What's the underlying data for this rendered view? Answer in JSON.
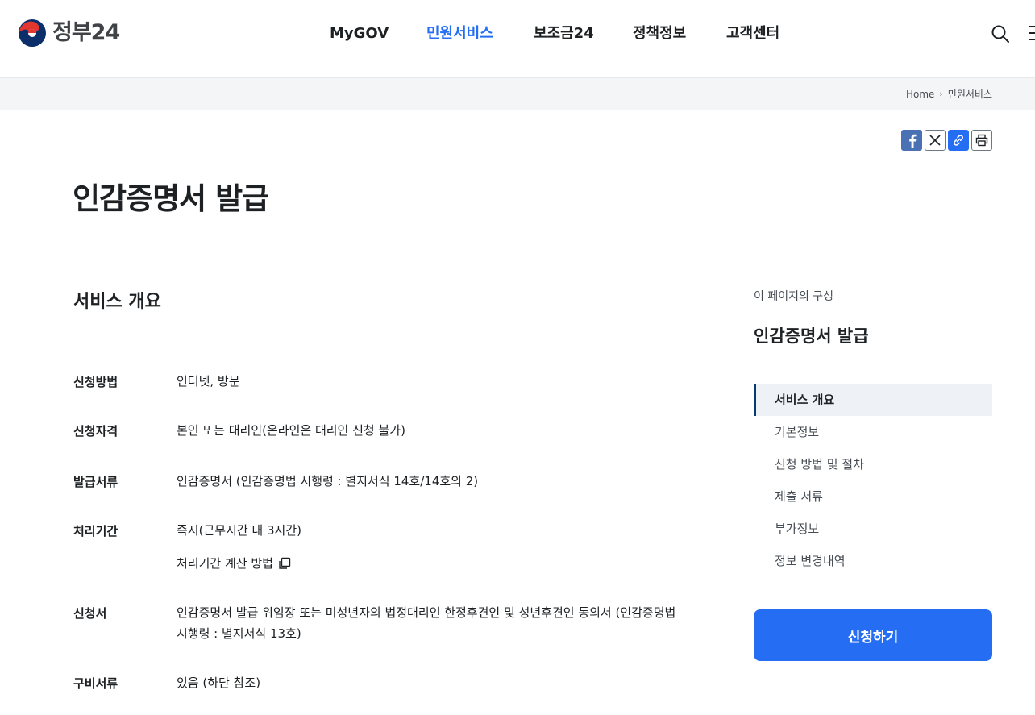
{
  "header": {
    "logo_text": "정부24",
    "nav": [
      {
        "label": "MyGOV",
        "active": false
      },
      {
        "label": "민원서비스",
        "active": true
      },
      {
        "label": "보조금24",
        "active": false
      },
      {
        "label": "정책정보",
        "active": false
      },
      {
        "label": "고객센터",
        "active": false
      }
    ],
    "search_icon": "search-icon",
    "menu_icon": "hamburger-menu-icon"
  },
  "breadcrumb": {
    "home": "Home",
    "current": "민원서비스"
  },
  "share": {
    "icons": [
      "facebook-icon",
      "x-icon",
      "link-icon",
      "print-icon"
    ]
  },
  "page": {
    "title": "인감증명서 발급"
  },
  "overview": {
    "section_title": "서비스 개요",
    "rows": [
      {
        "label": "신청방법",
        "value": "인터넷, 방문"
      },
      {
        "label": "신청자격",
        "value": "본인 또는 대리인(온라인은 대리인 신청 불가)"
      },
      {
        "label": "발급서류",
        "value": "인감증명서 (인감증명법 시행령 : 별지서식 14호/14호의 2)"
      },
      {
        "label": "처리기간",
        "value": "즉시(근무시간 내 3시간)"
      },
      {
        "label": "신청서",
        "value": "인감증명서 발급 위임장 또는 미성년자의 법정대리인 한정후견인 및 성년후견인 동의서 (인감증명법 시행령 : 별지서식 13호)"
      },
      {
        "label": "구비서류",
        "value": "있음 (하단 참조)"
      }
    ],
    "calc_link": "처리기간 계산 방법"
  },
  "sidebar": {
    "caption": "이 페이지의 구성",
    "title": "인감증명서 발급",
    "items": [
      {
        "label": "서비스 개요",
        "active": true
      },
      {
        "label": "기본정보",
        "active": false
      },
      {
        "label": "신청 방법 및 절차",
        "active": false
      },
      {
        "label": "제출 서류",
        "active": false
      },
      {
        "label": "부가정보",
        "active": false
      },
      {
        "label": "정보 변경내역",
        "active": false
      }
    ],
    "apply_button": "신청하기"
  },
  "colors": {
    "accent": "#256ef4",
    "toc_active_bar": "#063a74",
    "toc_active_bg": "#eef2f7",
    "facebook": "#4a71b4",
    "breadcrumb_bg": "#f4f5f6"
  }
}
